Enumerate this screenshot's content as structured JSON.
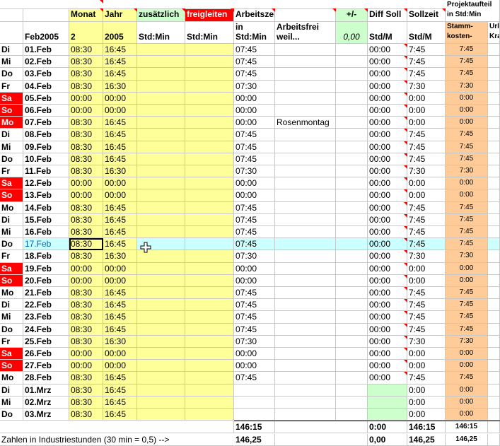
{
  "header": {
    "monat_label": "Monat",
    "jahr_label": "Jahr",
    "zusaetzlich_label": "zusätzlich",
    "freigeleiten_label": "freigleiten",
    "arbeitszeit_label": "Arbeitszeit",
    "plusminus_label": "+/-",
    "diffsoll_label": "Diff Soll",
    "sollzeit_label": "Sollzeit",
    "projekt_label": "Projektaufteil",
    "projekt_sub": "in Std:Min",
    "period_label": "Feb2005",
    "monat_value": "2",
    "jahr_value": "2005",
    "stdmin1": "Std:Min",
    "stdmin2": "Std:Min",
    "in_stdmin_line1": "in",
    "in_stdmin_line2": "Std:Min",
    "arbeitsfrei_line1": "Arbeitsfrei",
    "arbeitsfrei_line2": "weil...",
    "plusminus_value": "0,00",
    "stdm1": "Std/M",
    "stdm2": "Std/M",
    "stamm_line1": "Stamm-",
    "stamm_line2": "kosten-",
    "urlkra_line1": "Url",
    "urlkra_line2": "Kra"
  },
  "rows": [
    {
      "wd": "Di",
      "date": "01.Feb",
      "start": "08:30",
      "end": "16:45",
      "az": "07:45",
      "note": "",
      "diff": "00:00",
      "soll": "7:45",
      "proj": "7:45",
      "we": false
    },
    {
      "wd": "Mi",
      "date": "02.Feb",
      "start": "08:30",
      "end": "16:45",
      "az": "07:45",
      "note": "",
      "diff": "00:00",
      "soll": "7:45",
      "proj": "7:45",
      "we": false
    },
    {
      "wd": "Do",
      "date": "03.Feb",
      "start": "08:30",
      "end": "16:45",
      "az": "07:45",
      "note": "",
      "diff": "00:00",
      "soll": "7:45",
      "proj": "7:45",
      "we": false
    },
    {
      "wd": "Fr",
      "date": "04.Feb",
      "start": "08:30",
      "end": "16:30",
      "az": "07:30",
      "note": "",
      "diff": "00:00",
      "soll": "7:30",
      "proj": "7:30",
      "we": false
    },
    {
      "wd": "Sa",
      "date": "05.Feb",
      "start": "00:00",
      "end": "00:00",
      "az": "00:00",
      "note": "",
      "diff": "00:00",
      "soll": "0:00",
      "proj": "0:00",
      "we": true
    },
    {
      "wd": "So",
      "date": "06.Feb",
      "start": "00:00",
      "end": "00:00",
      "az": "00:00",
      "note": "",
      "diff": "00:00",
      "soll": "0:00",
      "proj": "0:00",
      "we": true
    },
    {
      "wd": "Mo",
      "date": "07.Feb",
      "start": "08:30",
      "end": "16:45",
      "az": "00:00",
      "note": "Rosenmontag",
      "diff": "00:00",
      "soll": "0:00",
      "proj": "0:00",
      "we": true
    },
    {
      "wd": "Di",
      "date": "08.Feb",
      "start": "08:30",
      "end": "16:45",
      "az": "07:45",
      "note": "",
      "diff": "00:00",
      "soll": "7:45",
      "proj": "7:45",
      "we": false
    },
    {
      "wd": "Mi",
      "date": "09.Feb",
      "start": "08:30",
      "end": "16:45",
      "az": "07:45",
      "note": "",
      "diff": "00:00",
      "soll": "7:45",
      "proj": "7:45",
      "we": false
    },
    {
      "wd": "Do",
      "date": "10.Feb",
      "start": "08:30",
      "end": "16:45",
      "az": "07:45",
      "note": "",
      "diff": "00:00",
      "soll": "7:45",
      "proj": "7:45",
      "we": false
    },
    {
      "wd": "Fr",
      "date": "11.Feb",
      "start": "08:30",
      "end": "16:30",
      "az": "07:30",
      "note": "",
      "diff": "00:00",
      "soll": "7:30",
      "proj": "7:30",
      "we": false
    },
    {
      "wd": "Sa",
      "date": "12.Feb",
      "start": "00:00",
      "end": "00:00",
      "az": "00:00",
      "note": "",
      "diff": "00:00",
      "soll": "0:00",
      "proj": "0:00",
      "we": true
    },
    {
      "wd": "So",
      "date": "13.Feb",
      "start": "00:00",
      "end": "00:00",
      "az": "00:00",
      "note": "",
      "diff": "00:00",
      "soll": "0:00",
      "proj": "0:00",
      "we": true
    },
    {
      "wd": "Mo",
      "date": "14.Feb",
      "start": "08:30",
      "end": "16:45",
      "az": "07:45",
      "note": "",
      "diff": "00:00",
      "soll": "7:45",
      "proj": "7:45",
      "we": false
    },
    {
      "wd": "Di",
      "date": "15.Feb",
      "start": "08:30",
      "end": "16:45",
      "az": "07:45",
      "note": "",
      "diff": "00:00",
      "soll": "7:45",
      "proj": "7:45",
      "we": false
    },
    {
      "wd": "Mi",
      "date": "16.Feb",
      "start": "08:30",
      "end": "16:45",
      "az": "07:45",
      "note": "",
      "diff": "00:00",
      "soll": "7:45",
      "proj": "7:45",
      "we": false
    },
    {
      "wd": "Do",
      "date": "17.Feb",
      "start": "08:30",
      "end": "16:45",
      "az": "07:45",
      "note": "",
      "diff": "00:00",
      "soll": "7:45",
      "proj": "7:45",
      "we": false,
      "active": true
    },
    {
      "wd": "Fr",
      "date": "18.Feb",
      "start": "08:30",
      "end": "16:30",
      "az": "07:30",
      "note": "",
      "diff": "00:00",
      "soll": "7:30",
      "proj": "7:30",
      "we": false
    },
    {
      "wd": "Sa",
      "date": "19.Feb",
      "start": "00:00",
      "end": "00:00",
      "az": "00:00",
      "note": "",
      "diff": "00:00",
      "soll": "0:00",
      "proj": "0:00",
      "we": true
    },
    {
      "wd": "So",
      "date": "20.Feb",
      "start": "00:00",
      "end": "00:00",
      "az": "00:00",
      "note": "",
      "diff": "00:00",
      "soll": "0:00",
      "proj": "0:00",
      "we": true
    },
    {
      "wd": "Mo",
      "date": "21.Feb",
      "start": "08:30",
      "end": "16:45",
      "az": "07:45",
      "note": "",
      "diff": "00:00",
      "soll": "7:45",
      "proj": "7:45",
      "we": false
    },
    {
      "wd": "Di",
      "date": "22.Feb",
      "start": "08:30",
      "end": "16:45",
      "az": "07:45",
      "note": "",
      "diff": "00:00",
      "soll": "7:45",
      "proj": "7:45",
      "we": false
    },
    {
      "wd": "Mi",
      "date": "23.Feb",
      "start": "08:30",
      "end": "16:45",
      "az": "07:45",
      "note": "",
      "diff": "00:00",
      "soll": "7:45",
      "proj": "7:45",
      "we": false
    },
    {
      "wd": "Do",
      "date": "24.Feb",
      "start": "08:30",
      "end": "16:45",
      "az": "07:45",
      "note": "",
      "diff": "00:00",
      "soll": "7:45",
      "proj": "7:45",
      "we": false
    },
    {
      "wd": "Fr",
      "date": "25.Feb",
      "start": "08:30",
      "end": "16:30",
      "az": "07:30",
      "note": "",
      "diff": "00:00",
      "soll": "7:30",
      "proj": "7:30",
      "we": false
    },
    {
      "wd": "Sa",
      "date": "26.Feb",
      "start": "00:00",
      "end": "00:00",
      "az": "00:00",
      "note": "",
      "diff": "00:00",
      "soll": "0:00",
      "proj": "0:00",
      "we": true
    },
    {
      "wd": "So",
      "date": "27.Feb",
      "start": "00:00",
      "end": "00:00",
      "az": "00:00",
      "note": "",
      "diff": "00:00",
      "soll": "0:00",
      "proj": "0:00",
      "we": true
    },
    {
      "wd": "Mo",
      "date": "28.Feb",
      "start": "08:30",
      "end": "16:45",
      "az": "07:45",
      "note": "",
      "diff": "00:00",
      "soll": "7:45",
      "proj": "7:45",
      "we": false
    },
    {
      "wd": "Di",
      "date": "01.Mrz",
      "start": "08:30",
      "end": "16:45",
      "az": "",
      "note": "",
      "diff": "",
      "soll": "0:00",
      "proj": "0:00",
      "we": false,
      "ext": true
    },
    {
      "wd": "Mi",
      "date": "02.Mrz",
      "start": "08:30",
      "end": "16:45",
      "az": "",
      "note": "",
      "diff": "",
      "soll": "0:00",
      "proj": "0:00",
      "we": false,
      "ext": true
    },
    {
      "wd": "Do",
      "date": "03.Mrz",
      "start": "08:30",
      "end": "16:45",
      "az": "",
      "note": "",
      "diff": "",
      "soll": "0:00",
      "proj": "0:00",
      "we": false,
      "ext": true
    }
  ],
  "totals": {
    "az_sum": "146:15",
    "diff_sum": "0:00",
    "soll_sum": "146:15",
    "proj_sum": "146:15",
    "industry_label": "Zahlen in Industriestunden (30 min = 0,5) -->",
    "az_ind": "146,25",
    "diff_ind": "0,00",
    "soll_ind": "146,25",
    "proj_ind": "146,25"
  },
  "colors": {
    "yellow": "#ffff99",
    "green": "#ccffcc",
    "red": "#ff0000",
    "orange": "#ffcc99",
    "cyan": "#ccffff"
  }
}
